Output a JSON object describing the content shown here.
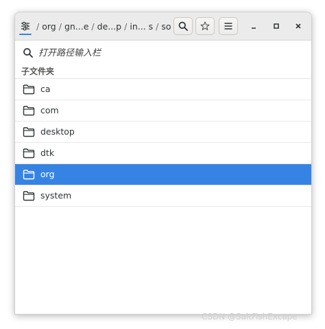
{
  "header": {
    "path_segments": [
      "org",
      "gn...e",
      "de...p",
      "in... s",
      "so...s"
    ],
    "separator": "/",
    "location_icon": "sliders-icon",
    "search_icon": "search-icon",
    "star_icon": "star-outline-icon",
    "menu_icon": "hamburger-menu-icon",
    "minimize_icon": "minimize-icon",
    "maximize_icon": "maximize-icon",
    "close_icon": "close-icon"
  },
  "search": {
    "placeholder": "打开路径输入栏"
  },
  "section": {
    "title": "子文件夹"
  },
  "folders": [
    {
      "name": "ca",
      "selected": false
    },
    {
      "name": "com",
      "selected": false
    },
    {
      "name": "desktop",
      "selected": false
    },
    {
      "name": "dtk",
      "selected": false
    },
    {
      "name": "org",
      "selected": true
    },
    {
      "name": "system",
      "selected": false
    }
  ],
  "colors": {
    "accent": "#3584e4",
    "header_bg": "#ebebeb"
  },
  "watermark": "CSDN @SaltFishExcape"
}
